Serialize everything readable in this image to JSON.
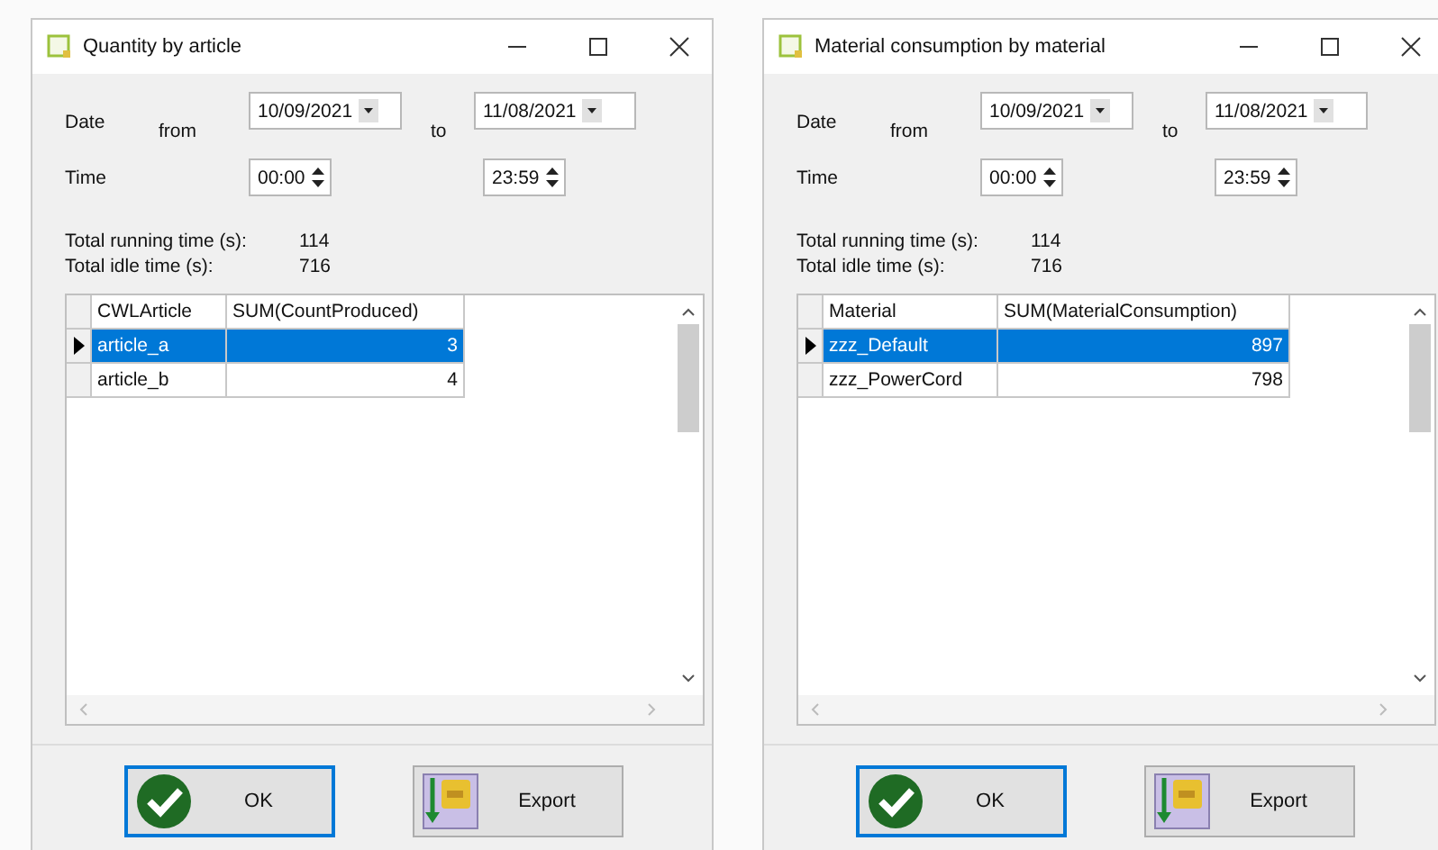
{
  "windows": [
    {
      "title": "Quantity by article",
      "date_label": "Date",
      "from_label": "from",
      "to_label": "to",
      "time_label": "Time",
      "from_date": "10/09/2021",
      "to_date": "11/08/2021",
      "from_time": "00:00",
      "to_time": "23:59",
      "totals": [
        {
          "label": "Total running time (s):",
          "value": "114"
        },
        {
          "label": "Total idle time (s):",
          "value": "716"
        }
      ],
      "columns": [
        {
          "label": "CWLArticle"
        },
        {
          "label": "SUM(CountProduced)"
        }
      ],
      "rows": [
        {
          "cells": [
            "article_a",
            "3"
          ],
          "selected": true
        },
        {
          "cells": [
            "article_b",
            "4"
          ],
          "selected": false
        }
      ],
      "buttons": [
        {
          "kind": "ok",
          "label": "OK",
          "focused": true
        },
        {
          "kind": "export",
          "label": "Export",
          "focused": false
        }
      ]
    },
    {
      "title": "Material consumption by material",
      "date_label": "Date",
      "from_label": "from",
      "to_label": "to",
      "time_label": "Time",
      "from_date": "10/09/2021",
      "to_date": "11/08/2021",
      "from_time": "00:00",
      "to_time": "23:59",
      "totals": [
        {
          "label": "Total running time (s):",
          "value": "114"
        },
        {
          "label": "Total idle time (s):",
          "value": "716"
        }
      ],
      "columns": [
        {
          "label": "Material"
        },
        {
          "label": "SUM(MaterialConsumption)"
        }
      ],
      "rows": [
        {
          "cells": [
            "zzz_Default",
            "897"
          ],
          "selected": true
        },
        {
          "cells": [
            "zzz_PowerCord",
            "798"
          ],
          "selected": false
        }
      ],
      "buttons": [
        {
          "kind": "ok",
          "label": "OK",
          "focused": true
        },
        {
          "kind": "export",
          "label": "Export",
          "focused": false
        }
      ]
    }
  ]
}
